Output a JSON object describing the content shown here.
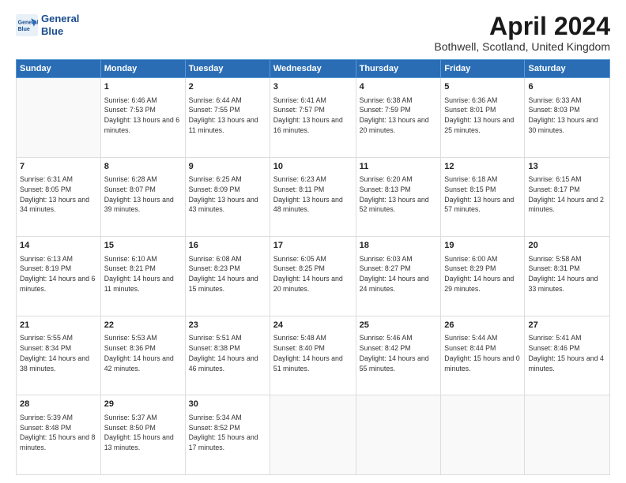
{
  "header": {
    "logo_line1": "General",
    "logo_line2": "Blue",
    "month_title": "April 2024",
    "location": "Bothwell, Scotland, United Kingdom"
  },
  "days_of_week": [
    "Sunday",
    "Monday",
    "Tuesday",
    "Wednesday",
    "Thursday",
    "Friday",
    "Saturday"
  ],
  "weeks": [
    [
      null,
      {
        "day": 1,
        "sunrise": "6:46 AM",
        "sunset": "7:53 PM",
        "daylight": "13 hours and 6 minutes."
      },
      {
        "day": 2,
        "sunrise": "6:44 AM",
        "sunset": "7:55 PM",
        "daylight": "13 hours and 11 minutes."
      },
      {
        "day": 3,
        "sunrise": "6:41 AM",
        "sunset": "7:57 PM",
        "daylight": "13 hours and 16 minutes."
      },
      {
        "day": 4,
        "sunrise": "6:38 AM",
        "sunset": "7:59 PM",
        "daylight": "13 hours and 20 minutes."
      },
      {
        "day": 5,
        "sunrise": "6:36 AM",
        "sunset": "8:01 PM",
        "daylight": "13 hours and 25 minutes."
      },
      {
        "day": 6,
        "sunrise": "6:33 AM",
        "sunset": "8:03 PM",
        "daylight": "13 hours and 30 minutes."
      }
    ],
    [
      {
        "day": 7,
        "sunrise": "6:31 AM",
        "sunset": "8:05 PM",
        "daylight": "13 hours and 34 minutes."
      },
      {
        "day": 8,
        "sunrise": "6:28 AM",
        "sunset": "8:07 PM",
        "daylight": "13 hours and 39 minutes."
      },
      {
        "day": 9,
        "sunrise": "6:25 AM",
        "sunset": "8:09 PM",
        "daylight": "13 hours and 43 minutes."
      },
      {
        "day": 10,
        "sunrise": "6:23 AM",
        "sunset": "8:11 PM",
        "daylight": "13 hours and 48 minutes."
      },
      {
        "day": 11,
        "sunrise": "6:20 AM",
        "sunset": "8:13 PM",
        "daylight": "13 hours and 52 minutes."
      },
      {
        "day": 12,
        "sunrise": "6:18 AM",
        "sunset": "8:15 PM",
        "daylight": "13 hours and 57 minutes."
      },
      {
        "day": 13,
        "sunrise": "6:15 AM",
        "sunset": "8:17 PM",
        "daylight": "14 hours and 2 minutes."
      }
    ],
    [
      {
        "day": 14,
        "sunrise": "6:13 AM",
        "sunset": "8:19 PM",
        "daylight": "14 hours and 6 minutes."
      },
      {
        "day": 15,
        "sunrise": "6:10 AM",
        "sunset": "8:21 PM",
        "daylight": "14 hours and 11 minutes."
      },
      {
        "day": 16,
        "sunrise": "6:08 AM",
        "sunset": "8:23 PM",
        "daylight": "14 hours and 15 minutes."
      },
      {
        "day": 17,
        "sunrise": "6:05 AM",
        "sunset": "8:25 PM",
        "daylight": "14 hours and 20 minutes."
      },
      {
        "day": 18,
        "sunrise": "6:03 AM",
        "sunset": "8:27 PM",
        "daylight": "14 hours and 24 minutes."
      },
      {
        "day": 19,
        "sunrise": "6:00 AM",
        "sunset": "8:29 PM",
        "daylight": "14 hours and 29 minutes."
      },
      {
        "day": 20,
        "sunrise": "5:58 AM",
        "sunset": "8:31 PM",
        "daylight": "14 hours and 33 minutes."
      }
    ],
    [
      {
        "day": 21,
        "sunrise": "5:55 AM",
        "sunset": "8:34 PM",
        "daylight": "14 hours and 38 minutes."
      },
      {
        "day": 22,
        "sunrise": "5:53 AM",
        "sunset": "8:36 PM",
        "daylight": "14 hours and 42 minutes."
      },
      {
        "day": 23,
        "sunrise": "5:51 AM",
        "sunset": "8:38 PM",
        "daylight": "14 hours and 46 minutes."
      },
      {
        "day": 24,
        "sunrise": "5:48 AM",
        "sunset": "8:40 PM",
        "daylight": "14 hours and 51 minutes."
      },
      {
        "day": 25,
        "sunrise": "5:46 AM",
        "sunset": "8:42 PM",
        "daylight": "14 hours and 55 minutes."
      },
      {
        "day": 26,
        "sunrise": "5:44 AM",
        "sunset": "8:44 PM",
        "daylight": "15 hours and 0 minutes."
      },
      {
        "day": 27,
        "sunrise": "5:41 AM",
        "sunset": "8:46 PM",
        "daylight": "15 hours and 4 minutes."
      }
    ],
    [
      {
        "day": 28,
        "sunrise": "5:39 AM",
        "sunset": "8:48 PM",
        "daylight": "15 hours and 8 minutes."
      },
      {
        "day": 29,
        "sunrise": "5:37 AM",
        "sunset": "8:50 PM",
        "daylight": "15 hours and 13 minutes."
      },
      {
        "day": 30,
        "sunrise": "5:34 AM",
        "sunset": "8:52 PM",
        "daylight": "15 hours and 17 minutes."
      },
      null,
      null,
      null,
      null
    ]
  ]
}
